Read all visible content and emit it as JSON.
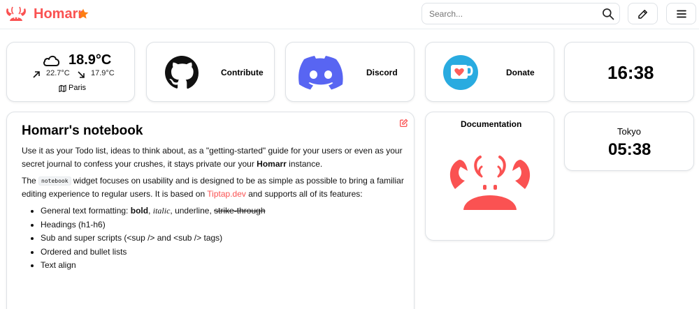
{
  "header": {
    "brand": "Homarr",
    "search_placeholder": "Search..."
  },
  "weather": {
    "temperature": "18.9°C",
    "high": "22.7°C",
    "low": "17.9°C",
    "location": "Paris"
  },
  "apps": [
    {
      "label": "Contribute"
    },
    {
      "label": "Discord"
    },
    {
      "label": "Donate"
    },
    {
      "label": "Documentation"
    }
  ],
  "clocks": [
    {
      "time": "16:38"
    },
    {
      "city": "Tokyo",
      "time": "05:38"
    }
  ],
  "notebook": {
    "title": "Homarr's notebook",
    "p1_a": "Use it as your Todo list, ideas to think about, as a \"getting-started\" guide for your users or even as your secret journal to confess your crushes, it stays private our your ",
    "p1_bold": "Homarr",
    "p1_b": " instance.",
    "p2_a": "The ",
    "p2_code": "notebook",
    "p2_b": " widget focuses on usability and is designed to be as simple as possible to bring a familiar editing experience to regular users. It is based on ",
    "p2_link": "Tiptap.dev",
    "p2_c": " and supports all of its features:",
    "li1_a": "General text formatting: ",
    "li1_bold": "bold",
    "li1_sep1": ", ",
    "li1_italic": "italic",
    "li1_sep2": ", underline, ",
    "li1_strike": "strike-through",
    "li2": "Headings (h1-h6)",
    "li3": "Sub and super scripts (<sup /> and <sub /> tags)",
    "li4": "Ordered and bullet lists",
    "li5": "Text align"
  },
  "colors": {
    "brand": "#fa5252",
    "star": "#fd7e14",
    "discord": "#5865F2",
    "kofi": "#29abe0"
  }
}
